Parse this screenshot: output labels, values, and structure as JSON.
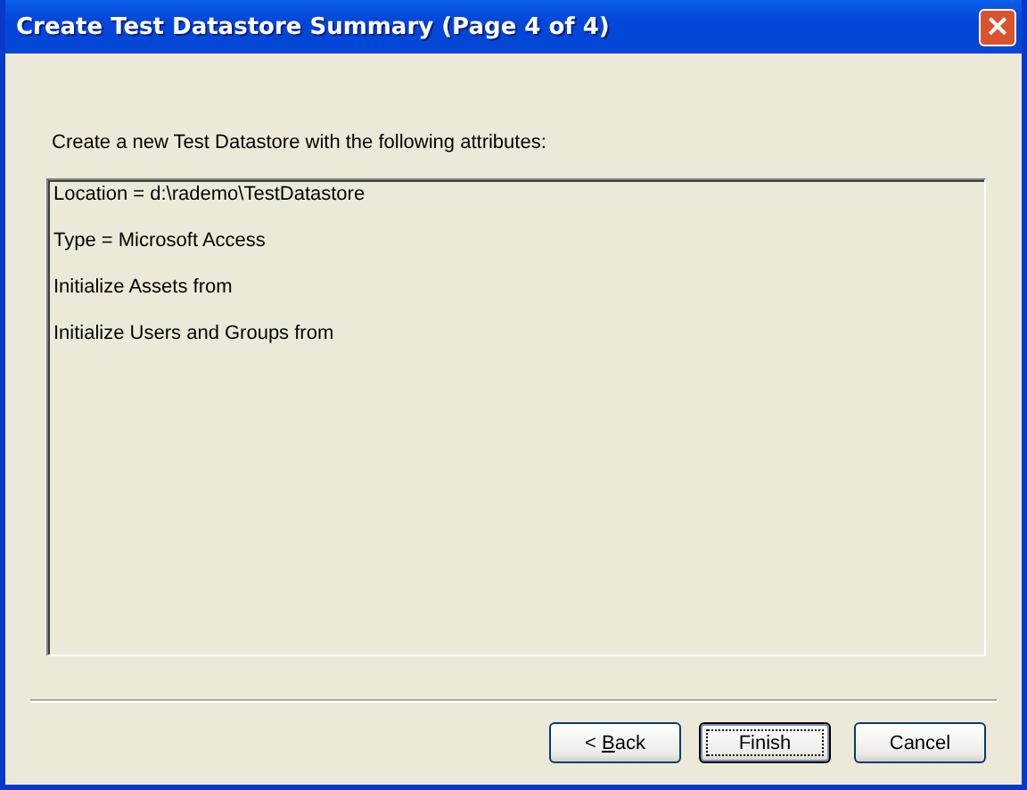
{
  "window": {
    "title": "Create Test Datastore Summary (Page 4 of 4)",
    "close_button": "×"
  },
  "intro": "Create a new Test Datastore with the following attributes:",
  "summary_lines": [
    "Location = d:\\rademo\\TestDatastore",
    "Type = Microsoft Access",
    "Initialize Assets from",
    "Initialize Users and Groups from"
  ],
  "buttons": [
    {
      "before": "< ",
      "mnemonic": "B",
      "after": "ack",
      "focused": false
    },
    {
      "after": "Finish",
      "focused": true
    },
    {
      "after": "Cancel",
      "focused": false
    }
  ]
}
